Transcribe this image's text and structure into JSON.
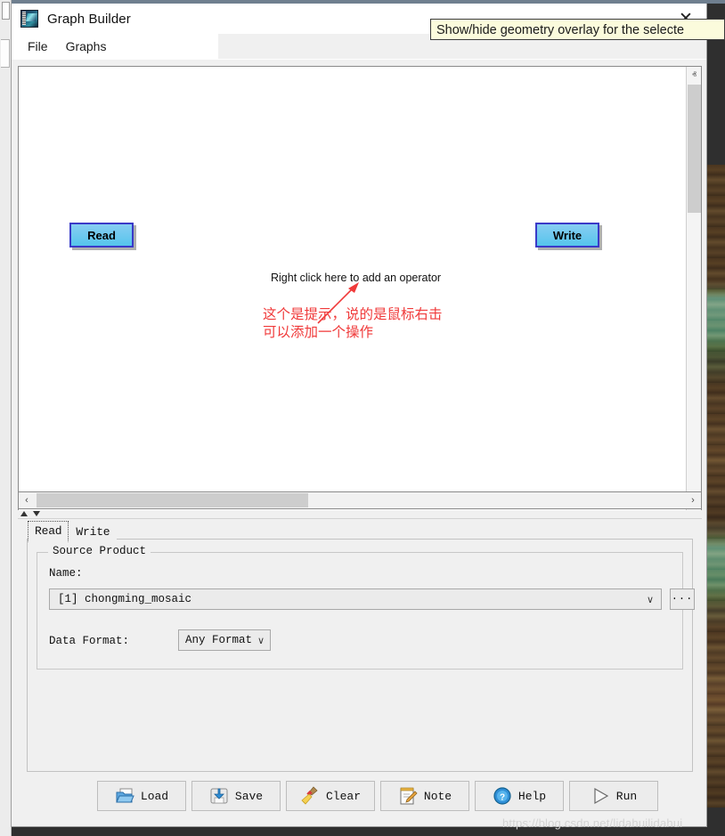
{
  "window": {
    "title": "Graph Builder",
    "app_icon": "snap-logo-icon",
    "close_label": "✕"
  },
  "tooltip": {
    "text": "Show/hide geometry overlay for the selecte"
  },
  "menu": {
    "items": [
      {
        "label": "File"
      },
      {
        "label": "Graphs"
      }
    ]
  },
  "canvas": {
    "nodes": [
      {
        "label": "Read"
      },
      {
        "label": "Write"
      }
    ],
    "hint": "Right click here to add an operator",
    "annotation_cn": "这个是提示，说的是鼠标右击\n可以添加一个操作",
    "annotation_color": "#f03a3a",
    "node_border_color": "#3a3ac8",
    "node_fill_top": "#87cdf2",
    "node_fill_bottom": "#55c5ec",
    "scroll_up_icon": "chevron-up-icon",
    "scroll_down_icon": "chevron-down-icon",
    "scroll_left_icon": "chevron-left-icon",
    "scroll_right_icon": "chevron-right-icon",
    "scroll_up_glyph": "ⱏ",
    "scroll_down_glyph": "ⱟ",
    "scroll_left_glyph": "‹",
    "scroll_right_glyph": "›"
  },
  "tabs": [
    {
      "label": "Read",
      "selected": true
    },
    {
      "label": "Write",
      "selected": false
    }
  ],
  "settings": {
    "group_title": "Source Product",
    "name_label": "Name:",
    "source_product_value": "[1] chongming_mosaic",
    "browse_label": "...",
    "data_format_label": "Data Format:",
    "data_format_value": "Any Format",
    "chevron_glyph": "∨"
  },
  "actions": [
    {
      "label": "Load",
      "icon": "folder-open-icon"
    },
    {
      "label": "Save",
      "icon": "floppy-disk-save-icon"
    },
    {
      "label": "Clear",
      "icon": "broom-icon"
    },
    {
      "label": "Note",
      "icon": "notepad-pencil-icon"
    },
    {
      "label": "Help",
      "icon": "question-circle-icon"
    },
    {
      "label": "Run",
      "icon": "play-triangle-icon"
    }
  ],
  "watermark": {
    "text": "https://blog.csdn.net/lidahuilidahui"
  }
}
